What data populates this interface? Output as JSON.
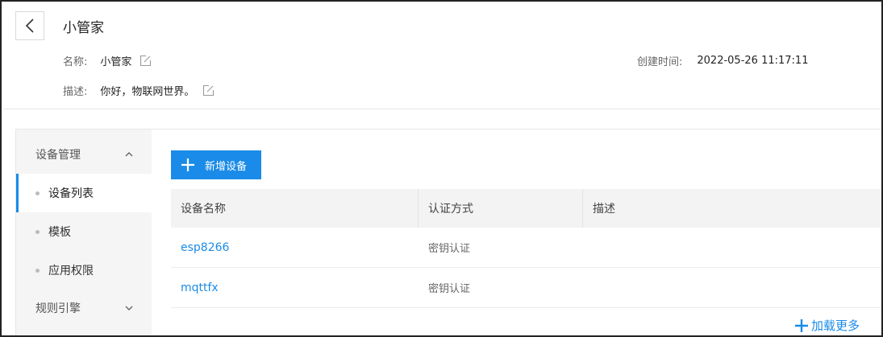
{
  "header": {
    "title": "小管家",
    "name_label": "名称:",
    "name_value": "小管家",
    "desc_label": "描述:",
    "desc_value": "你好，物联网世界。",
    "created_label": "创建时间:",
    "created_value": "2022-05-26 11:17:11"
  },
  "sidebar": {
    "groups": [
      {
        "label": "设备管理",
        "expanded": true
      },
      {
        "label": "规则引擎",
        "expanded": false
      }
    ],
    "items": [
      {
        "label": "设备列表",
        "active": true
      },
      {
        "label": "模板",
        "active": false
      },
      {
        "label": "应用权限",
        "active": false
      }
    ]
  },
  "main": {
    "add_device_label": "新增设备",
    "columns": [
      "设备名称",
      "认证方式",
      "描述"
    ],
    "rows": [
      {
        "name": "esp8266",
        "auth": "密钥认证",
        "desc": ""
      },
      {
        "name": "mqttfx",
        "auth": "密钥认证",
        "desc": ""
      }
    ],
    "load_more_label": "加载更多"
  },
  "colors": {
    "accent": "#1a8be8",
    "sidebar_bg": "#f5f5f5",
    "table_header_bg": "#f3f3f3"
  },
  "icons": {
    "back": "chevron-left-icon",
    "edit": "edit-icon",
    "collapse": "chevron-up-icon",
    "expand": "chevron-down-icon",
    "add": "plus-icon"
  }
}
